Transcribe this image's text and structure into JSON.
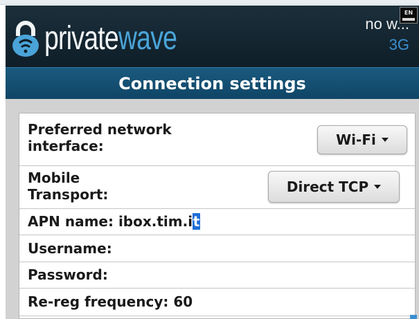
{
  "header": {
    "logo_private": "private",
    "logo_wave": "wave",
    "network_name": "no w...",
    "network_type": "3G",
    "language_badge": "EN"
  },
  "title": "Connection settings",
  "form": {
    "preferred_network": {
      "label_line1": "Preferred network",
      "label_line2": "interface:",
      "value": "Wi-Fi"
    },
    "mobile_transport": {
      "label_line1": "Mobile",
      "label_line2": "Transport:",
      "value": "Direct TCP"
    },
    "apn": {
      "label": "APN name:",
      "value": "ibox.tim.i",
      "cursor_char": "t"
    },
    "username": {
      "label": "Username:",
      "value": ""
    },
    "password": {
      "label": "Password:",
      "value": ""
    },
    "rereg": {
      "label": "Re-reg frequency:",
      "value": "60"
    }
  },
  "colors": {
    "header_bg": "#142630",
    "title_bar_bg": "#13506f",
    "logo_accent": "#4aa4d8",
    "cursor": "#1e6fd8"
  }
}
